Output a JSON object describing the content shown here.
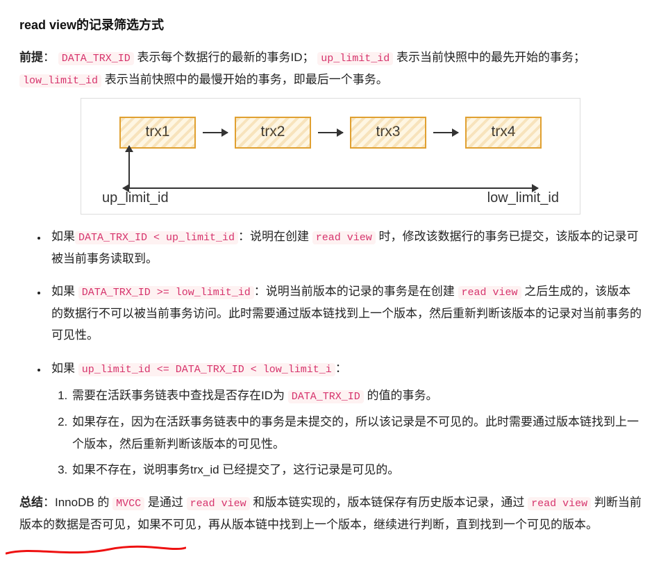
{
  "title": "read view的记录筛选方式",
  "premise": {
    "label": "前提",
    "seg1": "表示每个数据行的最新的事务ID；",
    "seg2": "表示当前快照中的最先开始的事务；",
    "seg3": "表示当前快照中的最慢开始的事务，即最后一个事务。",
    "code1": "DATA_TRX_ID",
    "code2": "up_limit_id",
    "code3": "low_limit_id"
  },
  "diagram": {
    "boxes": [
      "trx1",
      "trx2",
      "trx3",
      "trx4"
    ],
    "left_label": "up_limit_id",
    "right_label": "low_limit_id"
  },
  "bullets": {
    "b1_pre": "如果",
    "b1_code": "DATA_TRX_ID < up_limit_id",
    "b1_mid": "：说明在创建 ",
    "b1_code2": "read view",
    "b1_post": " 时，修改该数据行的事务已提交，该版本的记录可被当前事务读取到。",
    "b2_pre": "如果 ",
    "b2_code": "DATA_TRX_ID >= low_limit_id",
    "b2_mid": "：说明当前版本的记录的事务是在创建 ",
    "b2_code2": "read view",
    "b2_post": " 之后生成的，该版本的数据行不可以被当前事务访问。此时需要通过版本链找到上一个版本，然后重新判断该版本的记录对当前事务的可见性。",
    "b3_pre": "如果 ",
    "b3_code": "up_limit_id <= DATA_TRX_ID < low_limit_i",
    "b3_post": "：",
    "b3_items": {
      "i1_pre": "需要在活跃事务链表中查找是否存在ID为 ",
      "i1_code": "DATA_TRX_ID",
      "i1_post": " 的值的事务。",
      "i2": "如果存在，因为在活跃事务链表中的事务是未提交的，所以该记录是不可见的。此时需要通过版本链找到上一个版本，然后重新判断该版本的可见性。",
      "i3": "如果不存在，说明事务trx_id 已经提交了，这行记录是可见的。"
    }
  },
  "summary": {
    "label": "总结",
    "seg1": "：InnoDB 的 ",
    "code1": "MVCC",
    "seg2": " 是通过 ",
    "code2": "read view",
    "seg3": " 和版本链实现的，版本链保存有历史版本记录，通过 ",
    "code3": "read view",
    "seg4": " 判断当前版本的数据是否可见，如果不可见，再从版本链中找到上一个版本，继续进行判断，直到找到一个可见的版本。"
  }
}
